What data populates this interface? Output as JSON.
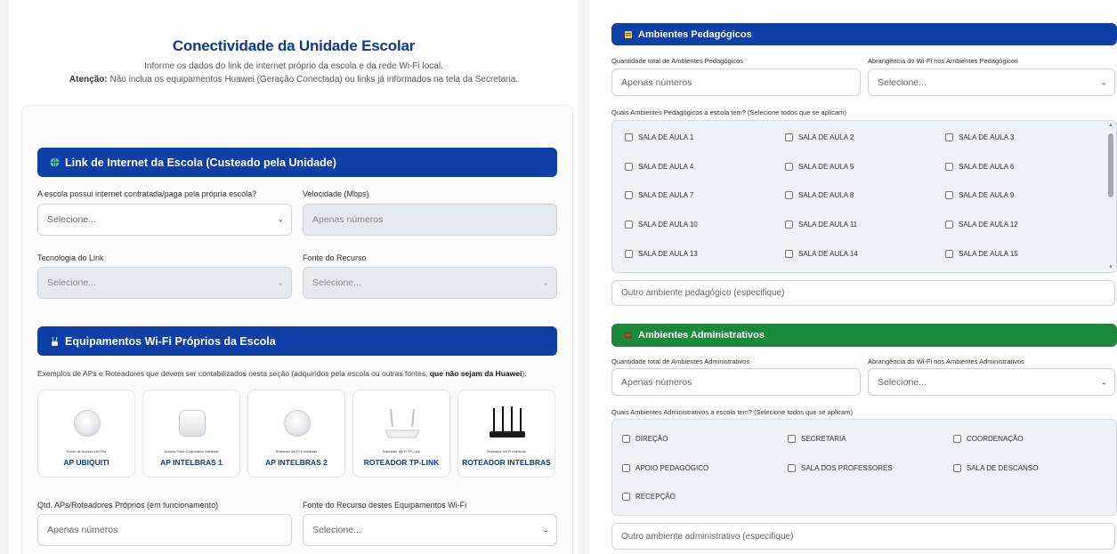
{
  "left": {
    "title": "Conectividade da Unidade Escolar",
    "subtitle": "Informe os dados do link de internet próprio da escola e da rede Wi-Fi local.",
    "warning_label": "Atenção:",
    "warning_text": " Não inclua os equipamentos Huawei (Geração Conectada) ou links já informados na tela da Secretaria.",
    "link_section": {
      "icon": "globe-icon",
      "title": "Link de Internet da Escola (Custeado pela Unidade)",
      "has_internet_label": "A escola possui internet contratada/paga pela própria escola?",
      "has_internet_value": "Selecione...",
      "speed_label": "Velocidade (Mbps)",
      "speed_placeholder": "Apenas números",
      "tech_label": "Tecnologia do Link",
      "tech_value": "Selecione...",
      "source_label": "Fonte do Recurso",
      "source_value": "Selecione..."
    },
    "wifi_section": {
      "icon": "router-icon",
      "title": "Equipamentos Wi-Fi Próprios da Escola",
      "examples_text": "Exemplos de APs e Roteadores que devem ser contabilizados nesta seção (adquiridos pela escola ou outras fontes, ",
      "examples_bold": "que não sejam da Huawei",
      "examples_end": "):",
      "equipment": [
        {
          "name": "AP UBIQUITI",
          "caption": "Ponto de Acesso Ubi Pro"
        },
        {
          "name": "AP INTELBRAS 1",
          "caption": "Access Point Corporativo Intelbras"
        },
        {
          "name": "AP INTELBRAS 2",
          "caption": "Roteador Wi-Fi 6 Intelbras"
        },
        {
          "name": "ROTEADOR TP-LINK",
          "caption": "Roteador Wi-Fi TP-Link"
        },
        {
          "name": "ROTEADOR INTELBRAS",
          "caption": "Roteador Wi-Fi Intelbras"
        }
      ],
      "qty_label": "Qtd. APs/Roteadores Próprios (em funcionamento)",
      "qty_placeholder": "Apenas números",
      "eq_source_label": "Fonte do Recurso destes Equipamentos Wi-Fi",
      "eq_source_value": "Selecione..."
    }
  },
  "right": {
    "pedagogic": {
      "icon": "book-icon",
      "title": "Ambientes Pedagógicos",
      "qty_label": "Quantidade total de Ambientes Pedagógicos",
      "qty_placeholder": "Apenas números",
      "coverage_label": "Abrangência do Wi-Fi nos Ambientes Pedagógicos",
      "coverage_value": "Selecione...",
      "which_label": "Quais Ambientes Pedagógicos a escola tem? (Selecione todos que se aplicam)",
      "rooms": [
        "SALA DE AULA 1",
        "SALA DE AULA 2",
        "SALA DE AULA 3",
        "SALA DE AULA 4",
        "SALA DE AULA 5",
        "SALA DE AULA 6",
        "SALA DE AULA 7",
        "SALA DE AULA 8",
        "SALA DE AULA 9",
        "SALA DE AULA 10",
        "SALA DE AULA 11",
        "SALA DE AULA 12",
        "SALA DE AULA 13",
        "SALA DE AULA 14",
        "SALA DE AULA 15"
      ],
      "other_placeholder": "Outro ambiente pedagógico (especifique)"
    },
    "administrative": {
      "icon": "cabinet-icon",
      "title": "Ambientes Administrativos",
      "qty_label": "Quantidade total de Ambientes Administrativos",
      "qty_placeholder": "Apenas números",
      "coverage_label": "Abrangência do Wi-Fi nos Ambientes Administrativos",
      "coverage_value": "Selecione...",
      "which_label": "Quais Ambientes Administrativos a escola tem? (Selecione todos que se aplicam)",
      "rooms": [
        "DIREÇÃO",
        "SECRETARIA",
        "COORDENAÇÃO",
        "APOIO PEDAGÓGICO",
        "SALA DOS PROFESSORES",
        "SALA DE DESCANSO",
        "RECEPÇÃO"
      ],
      "other_placeholder": "Outro ambiente administrativo (especifique)"
    }
  },
  "colors": {
    "primary_blue": "#0d3fa6",
    "title_blue": "#0b3a8f",
    "admin_green": "#1a8a3a"
  }
}
